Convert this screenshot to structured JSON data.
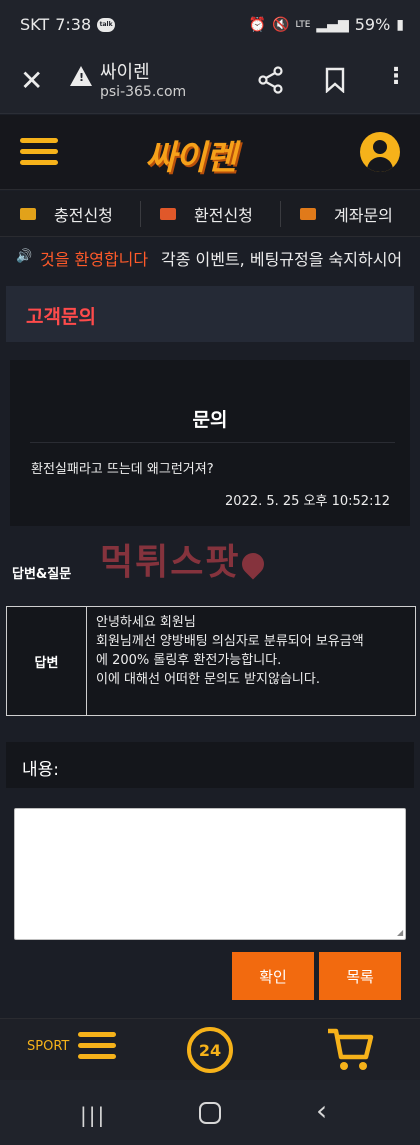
{
  "status_bar": {
    "carrier": "SKT",
    "time": "7:38",
    "notify_badge": "talk",
    "network": "LTE",
    "battery": "59%"
  },
  "browser": {
    "site_title": "싸이렌",
    "url": "psi-365.com"
  },
  "site": {
    "logo": "싸이렌"
  },
  "menu": {
    "items": [
      {
        "label": "충전신청",
        "icon_color": "#e2a21a"
      },
      {
        "label": "환전신청",
        "icon_color": "#e0582a"
      },
      {
        "label": "계좌문의",
        "icon_color": "#e07a1a"
      }
    ]
  },
  "ticker": {
    "highlight": "것을 환영합니다",
    "text": "각종 이벤트, 베팅규정을 숙지하시어"
  },
  "page": {
    "title": "고객문의"
  },
  "inquiry": {
    "heading": "문의",
    "question": "환전실패라고 뜨는데 왜그런거져?",
    "date": "2022. 5. 25 오후 10:52:12"
  },
  "reply": {
    "section_label": "답변&질문",
    "watermark": "먹튀스팟",
    "label": "답변",
    "lines": [
      "안녕하세요 회원님",
      "회원님께선 양방배팅 의심자로 분류되어 보유금액",
      "에 200% 롤링후 환전가능합니다.",
      "이에 대해선 어떠한 문의도 받지않습니다."
    ]
  },
  "form": {
    "content_label": "내용:",
    "content_value": "",
    "confirm_label": "확인",
    "list_label": "목록"
  },
  "bottom_nav": {
    "sport_label": "SPORT",
    "clock_label": "24"
  },
  "colors": {
    "accent": "#f6b21a",
    "button": "#f26a0f",
    "title_red": "#ff4b4b",
    "ticker_highlight": "#ff5a2a"
  }
}
